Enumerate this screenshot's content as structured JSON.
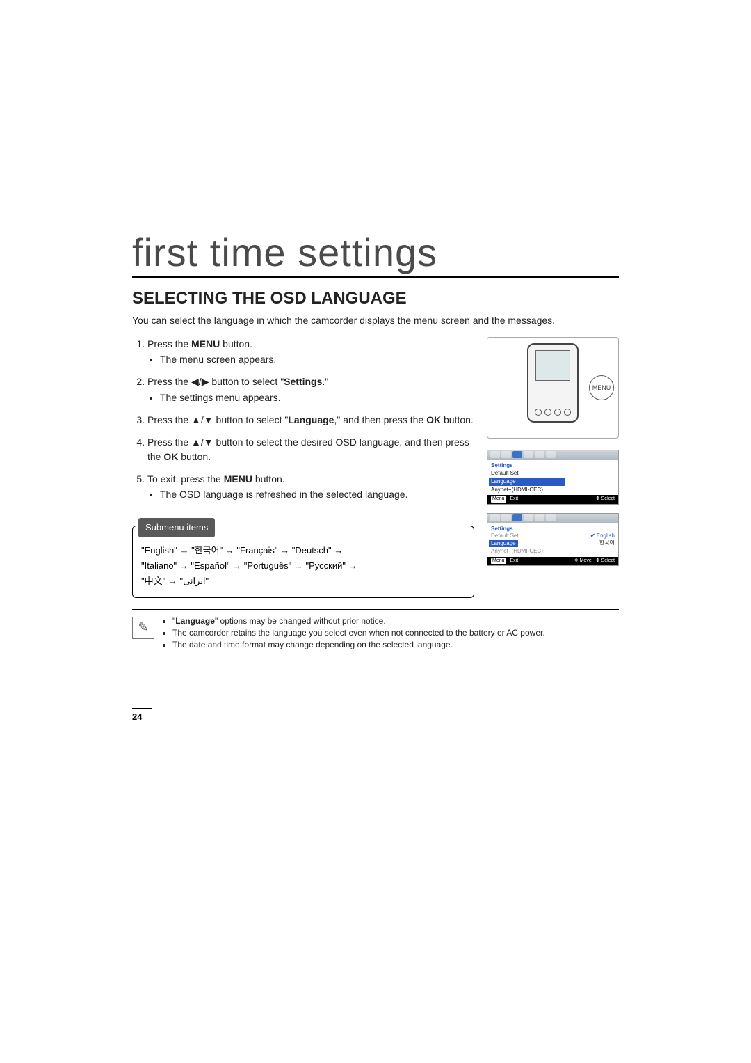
{
  "chapter_title": "first time settings",
  "heading": "SELECTING THE OSD LANGUAGE",
  "intro": "You can select the language in which the camcorder displays the menu screen and the messages.",
  "steps": {
    "s1_a": "Press the ",
    "s1_b": "MENU",
    "s1_c": " button.",
    "s1_sub": "The menu screen appears.",
    "s2_a": "Press the ",
    "s2_arrows": "◀/▶",
    "s2_b": " button to select \"",
    "s2_c": "Settings",
    "s2_d": ".\"",
    "s2_sub": "The settings menu appears.",
    "s3_a": "Press the ",
    "s3_arrows": "▲/▼",
    "s3_b": " button to select \"",
    "s3_c": "Language",
    "s3_d": ",\" and then press the ",
    "s3_e": "OK",
    "s3_f": " button.",
    "s4_a": "Press the ",
    "s4_arrows": "▲/▼",
    "s4_b": " button to select the desired OSD language, and then press the ",
    "s4_c": "OK",
    "s4_d": " button.",
    "s5_a": "To exit, press the ",
    "s5_b": "MENU",
    "s5_c": " button.",
    "s5_sub": "The OSD language is refreshed in the selected language."
  },
  "submenu": {
    "header": "Submenu items",
    "line1": "\"English\" → \"한국어\"   → \"Français\"  → \"Deutsch\"    →",
    "line2": "\"Italiano\" → \"Español\" → \"Português\" → \"Русский\"   →",
    "line3": "\"中文\"     → \"ايرانی\""
  },
  "notes": {
    "n1_a": "\"",
    "n1_b": "Language",
    "n1_c": "\" options may be changed without prior notice.",
    "n2": "The camcorder retains the language you select even when not connected to the battery or AC power.",
    "n3": "The date and time format may change depending on the selected language."
  },
  "diagram": {
    "menu_button": "MENU"
  },
  "osd1": {
    "title": "Settings",
    "row1": "Default Set",
    "row2": "Language",
    "row3": "Anynet+(HDMI-CEC)",
    "foot_menu": "Menu",
    "foot_exit": "Exit",
    "foot_select": "Select"
  },
  "osd2": {
    "title": "Settings",
    "row1_l": "Default Set",
    "row1_r": "English",
    "row2_l": "Language",
    "row2_r": "한국어",
    "row3_l": "Anynet+(HDMI-CEC)",
    "foot_menu": "Menu",
    "foot_exit": "Exit",
    "foot_move": "Move",
    "foot_select": "Select"
  },
  "page_number": "24"
}
